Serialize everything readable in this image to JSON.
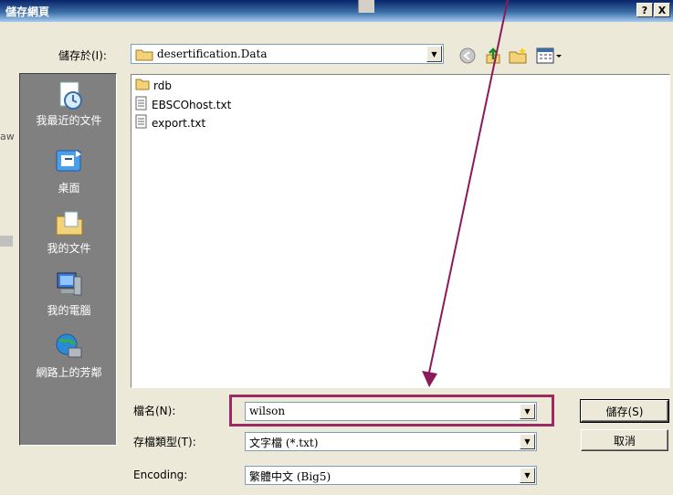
{
  "dialog": {
    "title": "儲存網頁",
    "help_label": "?",
    "close_label": "X"
  },
  "save_in": {
    "label": "儲存於(I):",
    "value": "desertification.Data"
  },
  "places": [
    {
      "label": "我最近的文件"
    },
    {
      "label": "桌面"
    },
    {
      "label": "我的文件"
    },
    {
      "label": "我的電腦"
    },
    {
      "label": "網路上的芳鄰"
    }
  ],
  "files": [
    {
      "name": "rdb",
      "type": "folder"
    },
    {
      "name": "EBSCOhost.txt",
      "type": "text"
    },
    {
      "name": "export.txt",
      "type": "text"
    }
  ],
  "filename": {
    "label": "檔名(N):",
    "value": "wilson"
  },
  "filetype": {
    "label": "存檔類型(T):",
    "value": "文字檔 (*.txt)"
  },
  "encoding": {
    "label": "Encoding:",
    "value": "繁體中文 (Big5)"
  },
  "buttons": {
    "save": "儲存(S)",
    "cancel": "取消"
  },
  "background_text": "aw",
  "colors": {
    "highlight_box": "#9b2a62",
    "annotation_arrow": "#8b1a5a",
    "title_bar": "#0a246a"
  },
  "icons": [
    "back-icon",
    "up-folder-icon",
    "new-folder-icon",
    "view-menu-icon"
  ]
}
